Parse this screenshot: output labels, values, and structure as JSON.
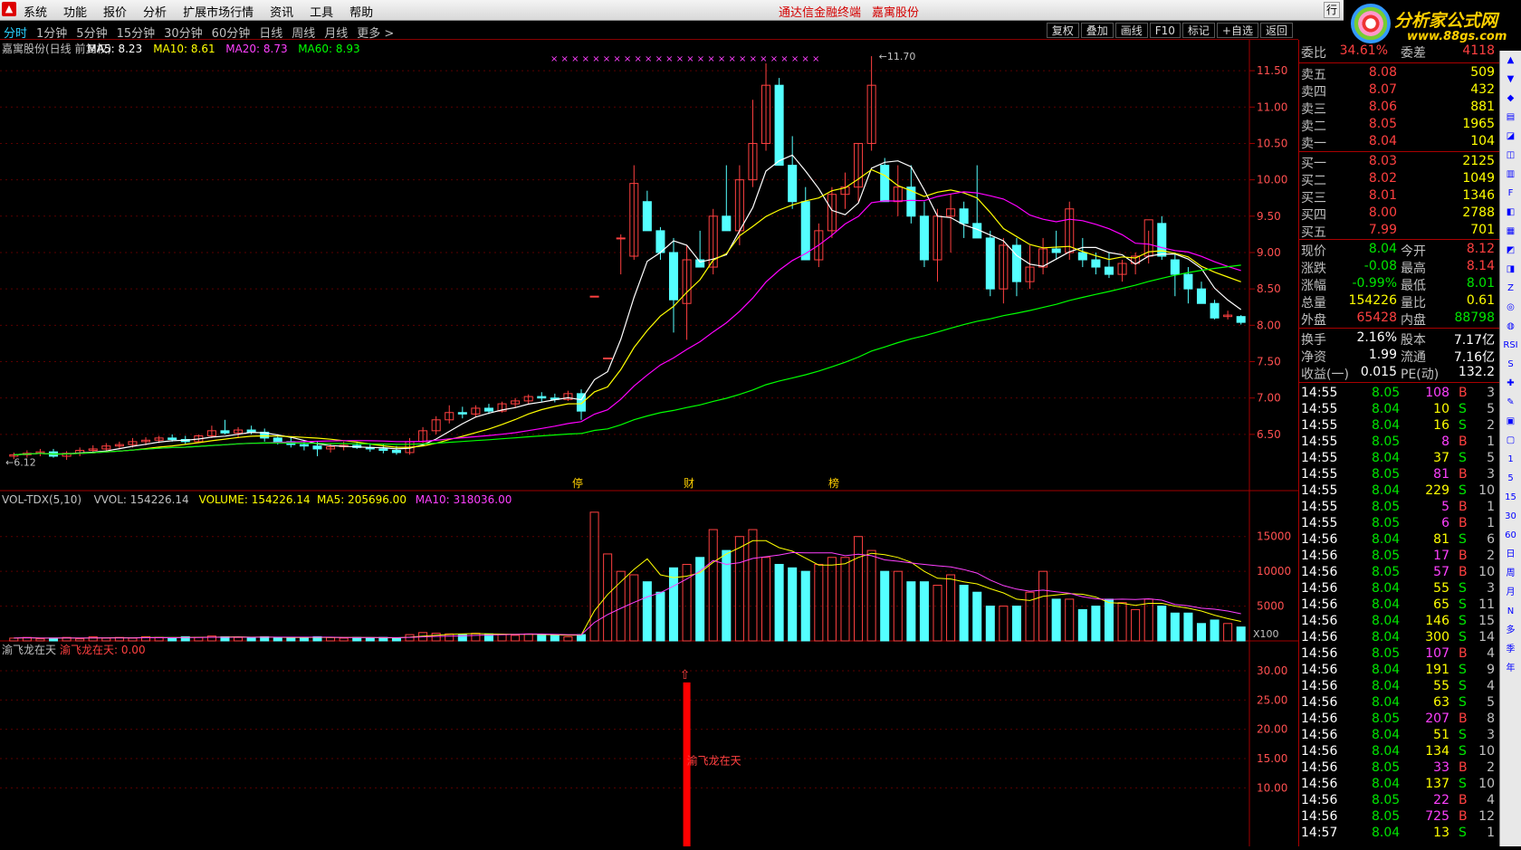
{
  "menu": {
    "items": [
      "系统",
      "功能",
      "报价",
      "分析",
      "扩展市场行情",
      "资讯",
      "工具",
      "帮助"
    ],
    "center_title": [
      "通达信金融终端",
      "嘉寓股份"
    ],
    "win_btn": "行"
  },
  "brand": {
    "title": "分析家公式网",
    "url": "www.88gs.com"
  },
  "tabs": {
    "items": [
      "分时",
      "1分钟",
      "5分钟",
      "15分钟",
      "30分钟",
      "60分钟",
      "日线",
      "周线",
      "月线",
      "更多 >"
    ],
    "tools": [
      "复权",
      "叠加",
      "画线",
      "F10",
      "标记",
      "+自选",
      "返回"
    ]
  },
  "chart_header": {
    "name": "嘉寓股份(日线 前复权)",
    "ma5": "MA5: 8.23",
    "ma10": "MA10: 8.61",
    "ma20": "MA20: 8.73",
    "ma60": "MA60: 8.93"
  },
  "price_axis": {
    "ticks": [
      "11.50",
      "11.00",
      "10.50",
      "10.00",
      "9.50",
      "9.00",
      "8.50",
      "8.00",
      "7.50",
      "7.00",
      "6.50"
    ],
    "ylim": [
      6.1,
      11.8
    ],
    "high_label": "11.70",
    "low_label": "6.12"
  },
  "chart_data": {
    "type": "candlestick",
    "candles": [
      [
        6.2,
        6.25,
        6.16,
        6.22
      ],
      [
        6.22,
        6.28,
        6.18,
        6.24
      ],
      [
        6.24,
        6.3,
        6.2,
        6.26
      ],
      [
        6.26,
        6.3,
        6.18,
        6.2
      ],
      [
        6.2,
        6.27,
        6.15,
        6.24
      ],
      [
        6.24,
        6.32,
        6.2,
        6.28
      ],
      [
        6.28,
        6.35,
        6.24,
        6.3
      ],
      [
        6.3,
        6.38,
        6.26,
        6.34
      ],
      [
        6.34,
        6.4,
        6.3,
        6.36
      ],
      [
        6.36,
        6.45,
        6.32,
        6.4
      ],
      [
        6.4,
        6.46,
        6.35,
        6.42
      ],
      [
        6.42,
        6.48,
        6.38,
        6.45
      ],
      [
        6.45,
        6.5,
        6.4,
        6.43
      ],
      [
        6.43,
        6.48,
        6.36,
        6.4
      ],
      [
        6.4,
        6.5,
        6.38,
        6.48
      ],
      [
        6.48,
        6.62,
        6.45,
        6.55
      ],
      [
        6.55,
        6.7,
        6.5,
        6.52
      ],
      [
        6.52,
        6.6,
        6.45,
        6.56
      ],
      [
        6.56,
        6.62,
        6.5,
        6.53
      ],
      [
        6.53,
        6.58,
        6.4,
        6.45
      ],
      [
        6.45,
        6.5,
        6.36,
        6.4
      ],
      [
        6.4,
        6.46,
        6.32,
        6.36
      ],
      [
        6.36,
        6.42,
        6.28,
        6.34
      ],
      [
        6.34,
        6.4,
        6.2,
        6.3
      ],
      [
        6.3,
        6.38,
        6.25,
        6.33
      ],
      [
        6.33,
        6.4,
        6.28,
        6.35
      ],
      [
        6.35,
        6.4,
        6.3,
        6.32
      ],
      [
        6.32,
        6.38,
        6.26,
        6.3
      ],
      [
        6.3,
        6.36,
        6.24,
        6.28
      ],
      [
        6.28,
        6.34,
        6.22,
        6.25
      ],
      [
        6.25,
        6.45,
        6.22,
        6.4
      ],
      [
        6.4,
        6.6,
        6.38,
        6.55
      ],
      [
        6.55,
        6.75,
        6.5,
        6.7
      ],
      [
        6.7,
        6.9,
        6.65,
        6.8
      ],
      [
        6.8,
        6.88,
        6.72,
        6.78
      ],
      [
        6.78,
        6.9,
        6.74,
        6.86
      ],
      [
        6.86,
        6.92,
        6.78,
        6.82
      ],
      [
        6.82,
        6.95,
        6.8,
        6.92
      ],
      [
        6.92,
        7.0,
        6.86,
        6.96
      ],
      [
        6.96,
        7.05,
        6.92,
        7.02
      ],
      [
        7.02,
        7.08,
        6.95,
        7.0
      ],
      [
        7.0,
        7.06,
        6.94,
        6.98
      ],
      [
        6.98,
        7.1,
        6.96,
        7.06
      ],
      [
        7.06,
        7.12,
        6.7,
        6.82
      ],
      [
        8.4,
        8.4,
        8.4,
        8.4
      ],
      [
        7.55,
        7.55,
        7.55,
        7.55
      ],
      [
        9.2,
        9.25,
        8.7,
        9.2
      ],
      [
        8.95,
        10.2,
        8.9,
        9.95
      ],
      [
        9.7,
        9.85,
        9.3,
        9.3
      ],
      [
        9.3,
        9.35,
        8.9,
        9.0
      ],
      [
        9.0,
        9.2,
        7.9,
        8.35
      ],
      [
        8.3,
        9.1,
        7.8,
        8.9
      ],
      [
        8.9,
        9.3,
        8.8,
        8.8
      ],
      [
        8.8,
        9.6,
        8.7,
        9.5
      ],
      [
        9.5,
        10.2,
        9.3,
        9.3
      ],
      [
        9.3,
        10.2,
        9.1,
        10.0
      ],
      [
        10.0,
        11.1,
        9.9,
        10.5
      ],
      [
        10.5,
        11.6,
        10.4,
        11.3
      ],
      [
        11.3,
        11.4,
        10.4,
        10.2
      ],
      [
        10.2,
        10.6,
        9.6,
        9.7
      ],
      [
        9.7,
        9.9,
        8.9,
        8.9
      ],
      [
        8.9,
        9.4,
        8.8,
        9.3
      ],
      [
        9.3,
        9.9,
        9.2,
        9.8
      ],
      [
        9.8,
        10.1,
        9.6,
        9.9
      ],
      [
        9.9,
        10.5,
        9.7,
        10.5
      ],
      [
        10.5,
        11.7,
        10.4,
        11.3
      ],
      [
        10.2,
        10.3,
        9.8,
        9.7
      ],
      [
        9.7,
        10.2,
        9.5,
        9.9
      ],
      [
        9.9,
        10.2,
        9.4,
        9.5
      ],
      [
        9.5,
        9.7,
        8.8,
        8.9
      ],
      [
        8.9,
        9.6,
        8.6,
        9.5
      ],
      [
        9.5,
        9.8,
        9.0,
        9.6
      ],
      [
        9.6,
        9.7,
        9.2,
        9.4
      ],
      [
        9.4,
        10.2,
        9.3,
        9.2
      ],
      [
        9.2,
        9.3,
        8.4,
        8.5
      ],
      [
        8.5,
        9.2,
        8.3,
        9.1
      ],
      [
        9.1,
        9.2,
        8.4,
        8.6
      ],
      [
        8.6,
        9.1,
        8.5,
        8.8
      ],
      [
        8.8,
        9.2,
        8.7,
        9.05
      ],
      [
        9.05,
        9.3,
        8.9,
        9.0
      ],
      [
        9.0,
        9.7,
        8.9,
        9.6
      ],
      [
        9.0,
        9.2,
        8.8,
        8.9
      ],
      [
        8.9,
        9.0,
        8.7,
        8.8
      ],
      [
        8.8,
        9.0,
        8.65,
        8.7
      ],
      [
        8.7,
        8.9,
        8.6,
        8.85
      ],
      [
        8.85,
        9.0,
        8.7,
        8.95
      ],
      [
        8.95,
        9.3,
        8.85,
        9.45
      ],
      [
        9.4,
        9.5,
        8.9,
        8.95
      ],
      [
        8.9,
        9.0,
        8.4,
        8.7
      ],
      [
        8.7,
        8.8,
        8.3,
        8.5
      ],
      [
        8.5,
        8.6,
        8.3,
        8.3
      ],
      [
        8.3,
        8.35,
        8.08,
        8.1
      ],
      [
        8.12,
        8.2,
        8.08,
        8.14
      ],
      [
        8.12,
        8.14,
        8.01,
        8.04
      ]
    ],
    "volume": [
      4,
      5,
      3,
      4,
      5,
      3,
      6,
      4,
      5,
      4,
      6,
      5,
      4,
      6,
      5,
      7,
      6,
      5,
      4,
      6,
      5,
      5,
      4,
      6,
      5,
      4,
      5,
      4,
      5,
      4,
      9,
      12,
      11,
      10,
      9,
      11,
      10,
      9,
      8,
      10,
      9,
      8,
      6,
      9,
      185,
      125,
      100,
      95,
      85,
      70,
      105,
      110,
      120,
      160,
      130,
      150,
      160,
      120,
      110,
      105,
      100,
      110,
      120,
      120,
      150,
      130,
      100,
      100,
      85,
      85,
      80,
      95,
      80,
      70,
      50,
      50,
      50,
      70,
      100,
      60,
      60,
      45,
      50,
      60,
      55,
      45,
      60,
      50,
      40,
      40,
      25,
      30,
      25,
      20
    ],
    "volume_ticks": [
      "15000",
      "10000",
      "5000"
    ],
    "volume_unit": "X100",
    "indicator_ticks": [
      "30.00",
      "25.00",
      "20.00",
      "15.00",
      "10.00"
    ]
  },
  "markers": {
    "x_row": "× × × × × × ×  ×  × × × × × ×   × × ×   × × ×  ×   ×  × × × ×",
    "events": [
      "停",
      "财",
      "榜"
    ]
  },
  "vol_header": {
    "name": "VOL-TDX(5,10)",
    "vvol": "VVOL: 154226.14",
    "volume": "VOLUME: 154226.14",
    "ma5": "MA5: 205696.00",
    "ma10": "MA10: 318036.00"
  },
  "ind_header": {
    "name": "渝飞龙在天",
    "val": "渝飞龙在天: 0.00",
    "signal": "渝飞龙在天"
  },
  "colors": {
    "up": "#ff4040",
    "down": "#54ffff",
    "ma5": "#ffffff",
    "ma10": "#ffff00",
    "ma20": "#ff00ff",
    "ma60": "#00ff00",
    "grid": "#a00000",
    "label_red": "#ff5050",
    "label_green": "#00e600"
  },
  "quote": {
    "order_ratio": {
      "l1": "委比",
      "v1": "34.61%",
      "l2": "委差",
      "v2": "4118"
    },
    "sells": [
      {
        "l": "卖五",
        "p": "8.08",
        "v": "509"
      },
      {
        "l": "卖四",
        "p": "8.07",
        "v": "432"
      },
      {
        "l": "卖三",
        "p": "8.06",
        "v": "881"
      },
      {
        "l": "卖二",
        "p": "8.05",
        "v": "1965"
      },
      {
        "l": "卖一",
        "p": "8.04",
        "v": "104"
      }
    ],
    "buys": [
      {
        "l": "买一",
        "p": "8.03",
        "v": "2125"
      },
      {
        "l": "买二",
        "p": "8.02",
        "v": "1049"
      },
      {
        "l": "买三",
        "p": "8.01",
        "v": "1346"
      },
      {
        "l": "买四",
        "p": "8.00",
        "v": "2788"
      },
      {
        "l": "买五",
        "p": "7.99",
        "v": "701"
      }
    ],
    "stats1": [
      {
        "l1": "现价",
        "v1": "8.04",
        "l2": "今开",
        "v2": "8.12"
      },
      {
        "l1": "涨跌",
        "v1": "-0.08",
        "l2": "最高",
        "v2": "8.14"
      },
      {
        "l1": "涨幅",
        "v1": "-0.99%",
        "l2": "最低",
        "v2": "8.01"
      },
      {
        "l1": "总量",
        "v1": "154226",
        "l2": "量比",
        "v2": "0.61"
      },
      {
        "l1": "外盘",
        "v1": "65428",
        "l2": "内盘",
        "v2": "88798"
      }
    ],
    "stats2": [
      {
        "l1": "换手",
        "v1": "2.16%",
        "l2": "股本",
        "v2": "7.17亿"
      },
      {
        "l1": "净资",
        "v1": "1.99",
        "l2": "流通",
        "v2": "7.16亿"
      },
      {
        "l1": "收益(一)",
        "v1": "0.015",
        "l2": "PE(动)",
        "v2": "132.2"
      }
    ]
  },
  "ticks": [
    [
      "14:55",
      "8.05",
      "108",
      "B",
      "3"
    ],
    [
      "14:55",
      "8.04",
      "10",
      "S",
      "5"
    ],
    [
      "14:55",
      "8.04",
      "16",
      "S",
      "2"
    ],
    [
      "14:55",
      "8.05",
      "8",
      "B",
      "1"
    ],
    [
      "14:55",
      "8.04",
      "37",
      "S",
      "5"
    ],
    [
      "14:55",
      "8.05",
      "81",
      "B",
      "3"
    ],
    [
      "14:55",
      "8.04",
      "229",
      "S",
      "10"
    ],
    [
      "14:55",
      "8.05",
      "5",
      "B",
      "1"
    ],
    [
      "14:55",
      "8.05",
      "6",
      "B",
      "1"
    ],
    [
      "14:56",
      "8.04",
      "81",
      "S",
      "6"
    ],
    [
      "14:56",
      "8.05",
      "17",
      "B",
      "2"
    ],
    [
      "14:56",
      "8.05",
      "57",
      "B",
      "10"
    ],
    [
      "14:56",
      "8.04",
      "55",
      "S",
      "3"
    ],
    [
      "14:56",
      "8.04",
      "65",
      "S",
      "11"
    ],
    [
      "14:56",
      "8.04",
      "146",
      "S",
      "15"
    ],
    [
      "14:56",
      "8.04",
      "300",
      "S",
      "14"
    ],
    [
      "14:56",
      "8.05",
      "107",
      "B",
      "4"
    ],
    [
      "14:56",
      "8.04",
      "191",
      "S",
      "9"
    ],
    [
      "14:56",
      "8.04",
      "55",
      "S",
      "4"
    ],
    [
      "14:56",
      "8.04",
      "63",
      "S",
      "5"
    ],
    [
      "14:56",
      "8.05",
      "207",
      "B",
      "8"
    ],
    [
      "14:56",
      "8.04",
      "51",
      "S",
      "3"
    ],
    [
      "14:56",
      "8.04",
      "134",
      "S",
      "10"
    ],
    [
      "14:56",
      "8.05",
      "33",
      "B",
      "2"
    ],
    [
      "14:56",
      "8.04",
      "137",
      "S",
      "10"
    ],
    [
      "14:56",
      "8.05",
      "22",
      "B",
      "4"
    ],
    [
      "14:56",
      "8.05",
      "725",
      "B",
      "12"
    ],
    [
      "14:57",
      "8.04",
      "13",
      "S",
      "1"
    ]
  ],
  "side_labels": [
    "1",
    "5",
    "15",
    "30",
    "60",
    "日",
    "周",
    "月",
    "N",
    "多",
    "季",
    "年"
  ]
}
